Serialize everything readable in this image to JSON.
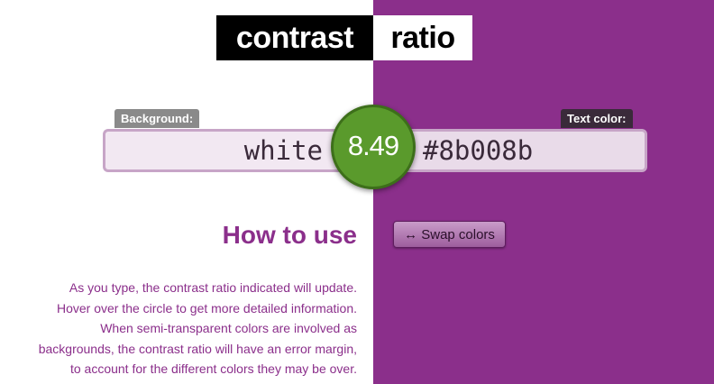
{
  "logo": {
    "left": "contrast",
    "right": "ratio"
  },
  "labels": {
    "background": "Background:",
    "text_color": "Text color:"
  },
  "inputs": {
    "background_value": "white",
    "foreground_value": "#8b008b"
  },
  "ratio": {
    "value": "8.49",
    "color": "#5a9a2c"
  },
  "howto": {
    "title": "How to use"
  },
  "swap": {
    "label": "↔ Swap colors"
  },
  "description": {
    "lines": [
      "As you type, the contrast ratio indicated will update.",
      "Hover over the circle to get more detailed information.",
      "When semi-transparent colors are involved as",
      "backgrounds, the contrast ratio will have an error margin,",
      "to account for the different colors they may be over."
    ]
  },
  "colors": {
    "background_swatch": "#ffffff",
    "foreground_swatch": "#8b2f8b"
  }
}
